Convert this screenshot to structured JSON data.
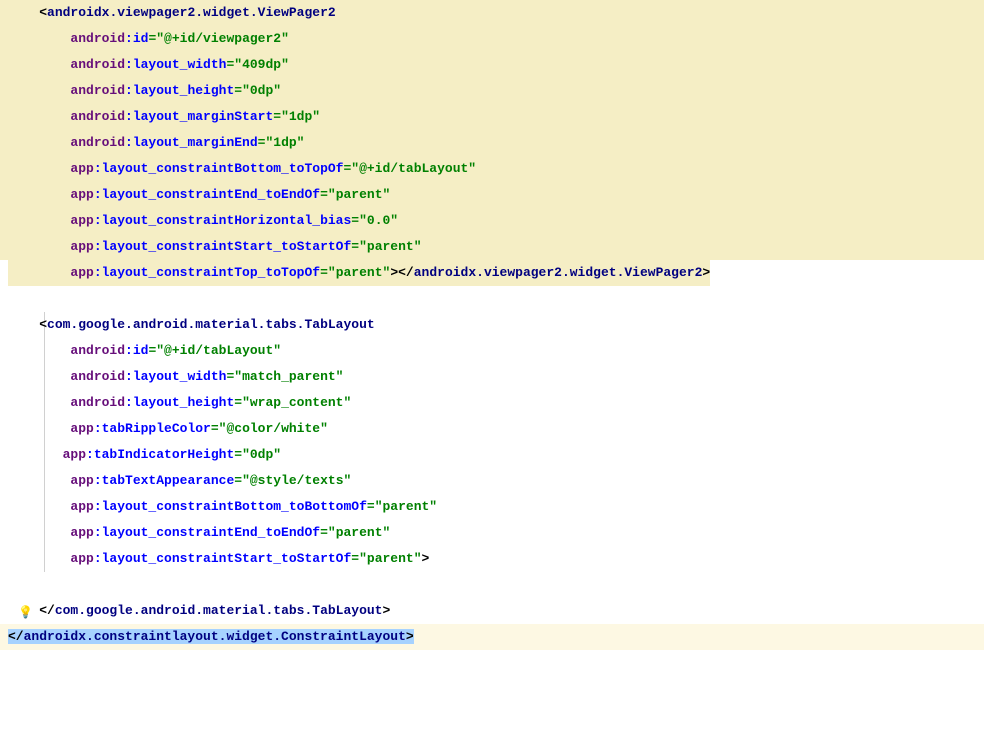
{
  "lines": [
    {
      "hl": "hl-yellow",
      "indent": "    ",
      "parts": [
        {
          "t": "<",
          "c": "tag-bracket"
        },
        {
          "t": "androidx.viewpager2.widget.ViewPager2",
          "c": "tag-name"
        }
      ]
    },
    {
      "hl": "hl-yellow",
      "indent": "        ",
      "parts": [
        {
          "t": "android",
          "c": "attr-ns"
        },
        {
          "t": ":id",
          "c": "attr-name"
        },
        {
          "t": "=",
          "c": "attr-eq"
        },
        {
          "t": "\"@+id/viewpager2\"",
          "c": "attr-value"
        }
      ]
    },
    {
      "hl": "hl-yellow",
      "indent": "        ",
      "parts": [
        {
          "t": "android",
          "c": "attr-ns"
        },
        {
          "t": ":layout_width",
          "c": "attr-name"
        },
        {
          "t": "=",
          "c": "attr-eq"
        },
        {
          "t": "\"409dp\"",
          "c": "attr-value"
        }
      ]
    },
    {
      "hl": "hl-yellow",
      "indent": "        ",
      "parts": [
        {
          "t": "android",
          "c": "attr-ns"
        },
        {
          "t": ":layout_height",
          "c": "attr-name"
        },
        {
          "t": "=",
          "c": "attr-eq"
        },
        {
          "t": "\"0dp\"",
          "c": "attr-value"
        }
      ]
    },
    {
      "hl": "hl-yellow",
      "indent": "        ",
      "parts": [
        {
          "t": "android",
          "c": "attr-ns"
        },
        {
          "t": ":layout_marginStart",
          "c": "attr-name"
        },
        {
          "t": "=",
          "c": "attr-eq"
        },
        {
          "t": "\"1dp\"",
          "c": "attr-value"
        }
      ]
    },
    {
      "hl": "hl-yellow",
      "indent": "        ",
      "parts": [
        {
          "t": "android",
          "c": "attr-ns"
        },
        {
          "t": ":layout_marginEnd",
          "c": "attr-name"
        },
        {
          "t": "=",
          "c": "attr-eq"
        },
        {
          "t": "\"1dp\"",
          "c": "attr-value"
        }
      ]
    },
    {
      "hl": "hl-yellow",
      "indent": "        ",
      "parts": [
        {
          "t": "app",
          "c": "attr-ns"
        },
        {
          "t": ":layout_constraintBottom_toTopOf",
          "c": "attr-name"
        },
        {
          "t": "=",
          "c": "attr-eq"
        },
        {
          "t": "\"@+id/tabLayout\"",
          "c": "attr-value"
        }
      ]
    },
    {
      "hl": "hl-yellow",
      "indent": "        ",
      "parts": [
        {
          "t": "app",
          "c": "attr-ns"
        },
        {
          "t": ":layout_constraintEnd_toEndOf",
          "c": "attr-name"
        },
        {
          "t": "=",
          "c": "attr-eq"
        },
        {
          "t": "\"parent\"",
          "c": "attr-value"
        }
      ]
    },
    {
      "hl": "hl-yellow",
      "indent": "        ",
      "parts": [
        {
          "t": "app",
          "c": "attr-ns"
        },
        {
          "t": ":layout_constraintHorizontal_bias",
          "c": "attr-name"
        },
        {
          "t": "=",
          "c": "attr-eq"
        },
        {
          "t": "\"0.0\"",
          "c": "attr-value"
        }
      ]
    },
    {
      "hl": "hl-yellow",
      "indent": "        ",
      "parts": [
        {
          "t": "app",
          "c": "attr-ns"
        },
        {
          "t": ":layout_constraintStart_toStartOf",
          "c": "attr-name"
        },
        {
          "t": "=",
          "c": "attr-eq"
        },
        {
          "t": "\"parent\"",
          "c": "attr-value"
        }
      ]
    },
    {
      "hl": "hl-light",
      "indent": "        ",
      "hlwidth": "880px",
      "parts": [
        {
          "t": "app",
          "c": "attr-ns"
        },
        {
          "t": ":layout_constraintTop_toTopOf",
          "c": "attr-name"
        },
        {
          "t": "=",
          "c": "attr-eq"
        },
        {
          "t": "\"parent\"",
          "c": "attr-value"
        },
        {
          "t": ">",
          "c": "tag-bracket"
        },
        {
          "t": "</",
          "c": "tag-bracket"
        },
        {
          "t": "androidx.viewpager2.widget.ViewPager2",
          "c": "tag-name"
        },
        {
          "t": ">",
          "c": "tag-bracket"
        }
      ]
    },
    {
      "hl": "",
      "indent": "",
      "parts": [
        {
          "t": " ",
          "c": ""
        }
      ]
    },
    {
      "hl": "",
      "indent": "    ",
      "parts": [
        {
          "t": "<",
          "c": "tag-bracket"
        },
        {
          "t": "com.google.android.material.tabs.TabLayout",
          "c": "tag-name"
        }
      ]
    },
    {
      "hl": "",
      "indent": "        ",
      "parts": [
        {
          "t": "android",
          "c": "attr-ns"
        },
        {
          "t": ":id",
          "c": "attr-name"
        },
        {
          "t": "=",
          "c": "attr-eq"
        },
        {
          "t": "\"@+id/tabLayout\"",
          "c": "attr-value"
        }
      ]
    },
    {
      "hl": "",
      "indent": "        ",
      "parts": [
        {
          "t": "android",
          "c": "attr-ns"
        },
        {
          "t": ":layout_width",
          "c": "attr-name"
        },
        {
          "t": "=",
          "c": "attr-eq"
        },
        {
          "t": "\"match_parent\"",
          "c": "attr-value"
        }
      ]
    },
    {
      "hl": "",
      "indent": "        ",
      "parts": [
        {
          "t": "android",
          "c": "attr-ns"
        },
        {
          "t": ":layout_height",
          "c": "attr-name"
        },
        {
          "t": "=",
          "c": "attr-eq"
        },
        {
          "t": "\"wrap_content\"",
          "c": "attr-value"
        }
      ]
    },
    {
      "hl": "",
      "indent": "        ",
      "parts": [
        {
          "t": "app",
          "c": "attr-ns"
        },
        {
          "t": ":tabRippleColor",
          "c": "attr-name"
        },
        {
          "t": "=",
          "c": "attr-eq"
        },
        {
          "t": "\"@color/white\"",
          "c": "attr-value"
        }
      ]
    },
    {
      "hl": "",
      "indent": "       ",
      "parts": [
        {
          "t": "app",
          "c": "attr-ns"
        },
        {
          "t": ":tabIndicatorHeight",
          "c": "attr-name"
        },
        {
          "t": "=",
          "c": "attr-eq"
        },
        {
          "t": "\"0dp\"",
          "c": "attr-value"
        }
      ]
    },
    {
      "hl": "",
      "indent": "        ",
      "parts": [
        {
          "t": "app",
          "c": "attr-ns"
        },
        {
          "t": ":tabTextAppearance",
          "c": "attr-name"
        },
        {
          "t": "=",
          "c": "attr-eq"
        },
        {
          "t": "\"@style/texts\"",
          "c": "attr-value"
        }
      ]
    },
    {
      "hl": "",
      "indent": "        ",
      "parts": [
        {
          "t": "app",
          "c": "attr-ns"
        },
        {
          "t": ":layout_constraintBottom_toBottomOf",
          "c": "attr-name"
        },
        {
          "t": "=",
          "c": "attr-eq"
        },
        {
          "t": "\"parent\"",
          "c": "attr-value"
        }
      ]
    },
    {
      "hl": "",
      "indent": "        ",
      "parts": [
        {
          "t": "app",
          "c": "attr-ns"
        },
        {
          "t": ":layout_constraintEnd_toEndOf",
          "c": "attr-name"
        },
        {
          "t": "=",
          "c": "attr-eq"
        },
        {
          "t": "\"parent\"",
          "c": "attr-value"
        }
      ]
    },
    {
      "hl": "",
      "indent": "        ",
      "parts": [
        {
          "t": "app",
          "c": "attr-ns"
        },
        {
          "t": ":layout_constraintStart_toStartOf",
          "c": "attr-name"
        },
        {
          "t": "=",
          "c": "attr-eq"
        },
        {
          "t": "\"parent\"",
          "c": "attr-value"
        },
        {
          "t": ">",
          "c": "tag-bracket"
        }
      ]
    },
    {
      "hl": "",
      "indent": "",
      "parts": [
        {
          "t": " ",
          "c": ""
        }
      ]
    },
    {
      "hl": "",
      "indent": "    ",
      "bulb": true,
      "parts": [
        {
          "t": "</",
          "c": "tag-bracket"
        },
        {
          "t": "com.google.android.material.tabs.TabLayout",
          "c": "tag-name"
        },
        {
          "t": ">",
          "c": "tag-bracket"
        }
      ]
    },
    {
      "hl": "hl-light",
      "indent": "",
      "selected": true,
      "parts": [
        {
          "t": "</",
          "c": "tag-bracket"
        },
        {
          "t": "androidx.constraintlayout.widget.ConstraintLayout",
          "c": "tag-name"
        },
        {
          "t": ">",
          "c": "tag-bracket"
        }
      ]
    }
  ]
}
